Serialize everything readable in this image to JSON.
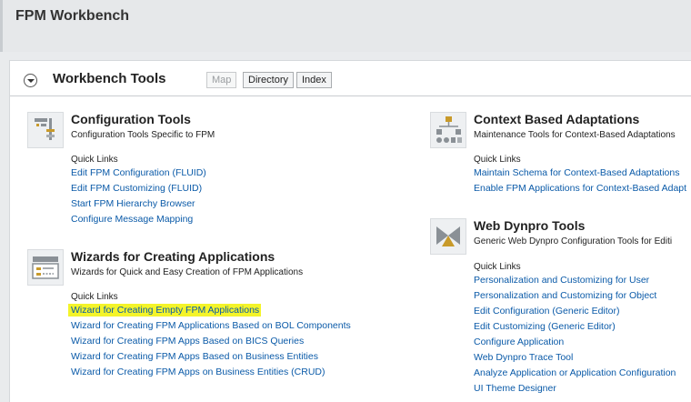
{
  "app": {
    "title": "FPM Workbench"
  },
  "panel": {
    "title": "Workbench Tools",
    "tabs": [
      {
        "label": "Map",
        "disabled": true
      },
      {
        "label": "Directory",
        "disabled": false
      },
      {
        "label": "Index",
        "disabled": false
      }
    ]
  },
  "tools": {
    "config": {
      "title": "Configuration Tools",
      "desc": "Configuration Tools Specific to FPM",
      "quick_links_label": "Quick Links",
      "links": [
        "Edit FPM Configuration (FLUID)",
        "Edit FPM Customizing (FLUID)",
        "Start FPM Hierarchy Browser",
        "Configure Message Mapping"
      ]
    },
    "wizards": {
      "title": "Wizards for Creating Applications",
      "desc": "Wizards for Quick and Easy Creation of FPM Applications",
      "quick_links_label": "Quick Links",
      "highlighted_index": 0,
      "links": [
        "Wizard for Creating Empty FPM Applications",
        "Wizard for Creating FPM Applications Based on BOL Components",
        "Wizard for Creating FPM Apps Based on BICS Queries",
        "Wizard for Creating FPM Apps Based on Business Entities",
        "Wizard for Creating FPM Apps on Business Entities (CRUD)"
      ]
    },
    "context": {
      "title": "Context Based Adaptations",
      "desc": "Maintenance Tools for Context-Based Adaptations",
      "quick_links_label": "Quick Links",
      "links": [
        "Maintain Schema for Context-Based Adaptations",
        "Enable FPM Applications for Context-Based Adapt"
      ]
    },
    "webdynpro": {
      "title": "Web Dynpro Tools",
      "desc": "Generic Web Dynpro Configuration Tools for Editi",
      "quick_links_label": "Quick Links",
      "links": [
        "Personalization and Customizing for User",
        "Personalization and Customizing for Object",
        "Edit Configuration (Generic Editor)",
        "Edit Customizing (Generic Editor)",
        "Configure Application",
        "Web Dynpro Trace Tool",
        "Analyze Application or Application Configuration",
        "UI Theme Designer"
      ]
    }
  },
  "colors": {
    "link": "#0a5aa8",
    "highlight": "#f4f42a"
  },
  "icons": {
    "config": "configuration-tools-icon",
    "wizards": "wizard-icon",
    "context": "context-adaptation-icon",
    "webdynpro": "web-dynpro-icon"
  }
}
